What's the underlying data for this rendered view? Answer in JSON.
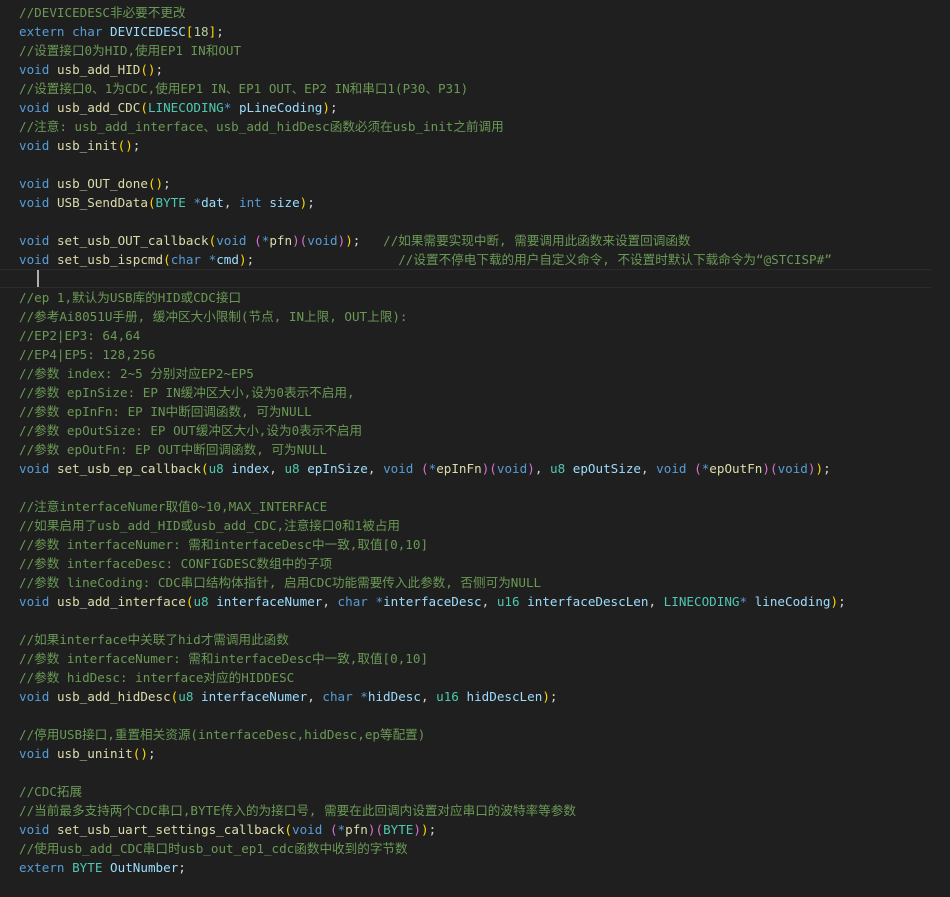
{
  "editor": {
    "theme": {
      "background": "#1f1f1f",
      "comment": "#6a9955",
      "keyword": "#569cd6",
      "type": "#4ec9b0",
      "function": "#dcdcaa",
      "identifier": "#9cdcfe",
      "punctuation": "#d4d4d4",
      "number": "#b5cea8",
      "bracket_1": "#ffd700",
      "bracket_2": "#da70d6",
      "bracket_3": "#179fff"
    },
    "active_line_index": 14,
    "lines": [
      [
        [
          "cm",
          "//DEVICEDESC非必要不更改"
        ]
      ],
      [
        [
          "kw",
          "extern"
        ],
        [
          "pn",
          " "
        ],
        [
          "kw",
          "char"
        ],
        [
          "pn",
          " "
        ],
        [
          "id",
          "DEVICEDESC"
        ],
        [
          "p1",
          "["
        ],
        [
          "nm",
          "18"
        ],
        [
          "p1",
          "]"
        ],
        [
          "pn",
          ";"
        ]
      ],
      [
        [
          "cm",
          "//设置接口0为HID,使用EP1 IN和OUT"
        ]
      ],
      [
        [
          "kw",
          "void"
        ],
        [
          "pn",
          " "
        ],
        [
          "fn",
          "usb_add_HID"
        ],
        [
          "p1",
          "()"
        ],
        [
          "pn",
          ";"
        ]
      ],
      [
        [
          "cm",
          "//设置接口0、1为CDC,使用EP1 IN、EP1 OUT、EP2 IN和串口1(P30、P31)"
        ]
      ],
      [
        [
          "kw",
          "void"
        ],
        [
          "pn",
          " "
        ],
        [
          "fn",
          "usb_add_CDC"
        ],
        [
          "p1",
          "("
        ],
        [
          "ty",
          "LINECODING"
        ],
        [
          "kw",
          "*"
        ],
        [
          "pn",
          " "
        ],
        [
          "id",
          "pLineCoding"
        ],
        [
          "p1",
          ")"
        ],
        [
          "pn",
          ";"
        ]
      ],
      [
        [
          "cm",
          "//注意: usb_add_interface、usb_add_hidDesc函数必须在usb_init之前调用"
        ]
      ],
      [
        [
          "kw",
          "void"
        ],
        [
          "pn",
          " "
        ],
        [
          "fn",
          "usb_init"
        ],
        [
          "p1",
          "()"
        ],
        [
          "pn",
          ";"
        ]
      ],
      [],
      [
        [
          "kw",
          "void"
        ],
        [
          "pn",
          " "
        ],
        [
          "fn",
          "usb_OUT_done"
        ],
        [
          "p1",
          "()"
        ],
        [
          "pn",
          ";"
        ]
      ],
      [
        [
          "kw",
          "void"
        ],
        [
          "pn",
          " "
        ],
        [
          "fn",
          "USB_SendData"
        ],
        [
          "p1",
          "("
        ],
        [
          "ty",
          "BYTE"
        ],
        [
          "pn",
          " "
        ],
        [
          "kw",
          "*"
        ],
        [
          "id",
          "dat"
        ],
        [
          "pn",
          ", "
        ],
        [
          "kw",
          "int"
        ],
        [
          "pn",
          " "
        ],
        [
          "id",
          "size"
        ],
        [
          "p1",
          ")"
        ],
        [
          "pn",
          ";"
        ]
      ],
      [],
      [
        [
          "kw",
          "void"
        ],
        [
          "pn",
          " "
        ],
        [
          "fn",
          "set_usb_OUT_callback"
        ],
        [
          "p1",
          "("
        ],
        [
          "kw",
          "void"
        ],
        [
          "pn",
          " "
        ],
        [
          "p2",
          "("
        ],
        [
          "kw",
          "*"
        ],
        [
          "fn",
          "pfn"
        ],
        [
          "p2",
          ")"
        ],
        [
          "p2",
          "("
        ],
        [
          "kw",
          "void"
        ],
        [
          "p2",
          ")"
        ],
        [
          "p1",
          ")"
        ],
        [
          "pn",
          ";   "
        ],
        [
          "cm",
          "//如果需要实现中断, 需要调用此函数来设置回调函数"
        ]
      ],
      [
        [
          "kw",
          "void"
        ],
        [
          "pn",
          " "
        ],
        [
          "fn",
          "set_usb_ispcmd"
        ],
        [
          "p1",
          "("
        ],
        [
          "kw",
          "char"
        ],
        [
          "pn",
          " "
        ],
        [
          "kw",
          "*"
        ],
        [
          "id",
          "cmd"
        ],
        [
          "p1",
          ")"
        ],
        [
          "pn",
          ";                   "
        ],
        [
          "cm",
          "//设置不停电下载的用户自定义命令, 不设置时默认下载命令为“@STCISP#”"
        ]
      ],
      [],
      [
        [
          "cm",
          "//ep 1,默认为USB库的HID或CDC接口"
        ]
      ],
      [
        [
          "cm",
          "//参考Ai8051U手册, 缓冲区大小限制(节点, IN上限, OUT上限):"
        ]
      ],
      [
        [
          "cm",
          "//EP2|EP3: 64,64"
        ]
      ],
      [
        [
          "cm",
          "//EP4|EP5: 128,256"
        ]
      ],
      [
        [
          "cm",
          "//参数 index: 2~5 分别对应EP2~EP5"
        ]
      ],
      [
        [
          "cm",
          "//参数 epInSize: EP IN缓冲区大小,设为0表示不启用,"
        ]
      ],
      [
        [
          "cm",
          "//参数 epInFn: EP IN中断回调函数, 可为NULL"
        ]
      ],
      [
        [
          "cm",
          "//参数 epOutSize: EP OUT缓冲区大小,设为0表示不启用"
        ]
      ],
      [
        [
          "cm",
          "//参数 epOutFn: EP OUT中断回调函数, 可为NULL"
        ]
      ],
      [
        [
          "kw",
          "void"
        ],
        [
          "pn",
          " "
        ],
        [
          "fn",
          "set_usb_ep_callback"
        ],
        [
          "p1",
          "("
        ],
        [
          "ty",
          "u8"
        ],
        [
          "pn",
          " "
        ],
        [
          "id",
          "index"
        ],
        [
          "pn",
          ", "
        ],
        [
          "ty",
          "u8"
        ],
        [
          "pn",
          " "
        ],
        [
          "id",
          "epInSize"
        ],
        [
          "pn",
          ", "
        ],
        [
          "kw",
          "void"
        ],
        [
          "pn",
          " "
        ],
        [
          "p2",
          "("
        ],
        [
          "kw",
          "*"
        ],
        [
          "fn",
          "epInFn"
        ],
        [
          "p2",
          ")"
        ],
        [
          "p2",
          "("
        ],
        [
          "kw",
          "void"
        ],
        [
          "p2",
          ")"
        ],
        [
          "pn",
          ", "
        ],
        [
          "ty",
          "u8"
        ],
        [
          "pn",
          " "
        ],
        [
          "id",
          "epOutSize"
        ],
        [
          "pn",
          ", "
        ],
        [
          "kw",
          "void"
        ],
        [
          "pn",
          " "
        ],
        [
          "p2",
          "("
        ],
        [
          "kw",
          "*"
        ],
        [
          "fn",
          "epOutFn"
        ],
        [
          "p2",
          ")"
        ],
        [
          "p2",
          "("
        ],
        [
          "kw",
          "void"
        ],
        [
          "p2",
          ")"
        ],
        [
          "p1",
          ")"
        ],
        [
          "pn",
          ";"
        ]
      ],
      [],
      [
        [
          "cm",
          "//注意interfaceNumer取值0~10,MAX_INTERFACE"
        ]
      ],
      [
        [
          "cm",
          "//如果启用了usb_add_HID或usb_add_CDC,注意接口0和1被占用"
        ]
      ],
      [
        [
          "cm",
          "//参数 interfaceNumer: 需和interfaceDesc中一致,取值[0,10]"
        ]
      ],
      [
        [
          "cm",
          "//参数 interfaceDesc: CONFIGDESC数组中的子项"
        ]
      ],
      [
        [
          "cm",
          "//参数 lineCoding: CDC串口结构体指针, 启用CDC功能需要传入此参数, 否侧可为NULL"
        ]
      ],
      [
        [
          "kw",
          "void"
        ],
        [
          "pn",
          " "
        ],
        [
          "fn",
          "usb_add_interface"
        ],
        [
          "p1",
          "("
        ],
        [
          "ty",
          "u8"
        ],
        [
          "pn",
          " "
        ],
        [
          "id",
          "interfaceNumer"
        ],
        [
          "pn",
          ", "
        ],
        [
          "kw",
          "char"
        ],
        [
          "pn",
          " "
        ],
        [
          "kw",
          "*"
        ],
        [
          "id",
          "interfaceDesc"
        ],
        [
          "pn",
          ", "
        ],
        [
          "ty",
          "u16"
        ],
        [
          "pn",
          " "
        ],
        [
          "id",
          "interfaceDescLen"
        ],
        [
          "pn",
          ", "
        ],
        [
          "ty",
          "LINECODING"
        ],
        [
          "kw",
          "*"
        ],
        [
          "pn",
          " "
        ],
        [
          "id",
          "lineCoding"
        ],
        [
          "p1",
          ")"
        ],
        [
          "pn",
          ";"
        ]
      ],
      [],
      [
        [
          "cm",
          "//如果interface中关联了hid才需调用此函数"
        ]
      ],
      [
        [
          "cm",
          "//参数 interfaceNumer: 需和interfaceDesc中一致,取值[0,10]"
        ]
      ],
      [
        [
          "cm",
          "//参数 hidDesc: interface对应的HIDDESC"
        ]
      ],
      [
        [
          "kw",
          "void"
        ],
        [
          "pn",
          " "
        ],
        [
          "fn",
          "usb_add_hidDesc"
        ],
        [
          "p1",
          "("
        ],
        [
          "ty",
          "u8"
        ],
        [
          "pn",
          " "
        ],
        [
          "id",
          "interfaceNumer"
        ],
        [
          "pn",
          ", "
        ],
        [
          "kw",
          "char"
        ],
        [
          "pn",
          " "
        ],
        [
          "kw",
          "*"
        ],
        [
          "id",
          "hidDesc"
        ],
        [
          "pn",
          ", "
        ],
        [
          "ty",
          "u16"
        ],
        [
          "pn",
          " "
        ],
        [
          "id",
          "hidDescLen"
        ],
        [
          "p1",
          ")"
        ],
        [
          "pn",
          ";"
        ]
      ],
      [],
      [
        [
          "cm",
          "//停用USB接口,重置相关资源(interfaceDesc,hidDesc,ep等配置)"
        ]
      ],
      [
        [
          "kw",
          "void"
        ],
        [
          "pn",
          " "
        ],
        [
          "fn",
          "usb_uninit"
        ],
        [
          "p1",
          "()"
        ],
        [
          "pn",
          ";"
        ]
      ],
      [],
      [
        [
          "cm",
          "//CDC拓展"
        ]
      ],
      [
        [
          "cm",
          "//当前最多支持两个CDC串口,BYTE传入的为接口号, 需要在此回调内设置对应串口的波特率等参数"
        ]
      ],
      [
        [
          "kw",
          "void"
        ],
        [
          "pn",
          " "
        ],
        [
          "fn",
          "set_usb_uart_settings_callback"
        ],
        [
          "p1",
          "("
        ],
        [
          "kw",
          "void"
        ],
        [
          "pn",
          " "
        ],
        [
          "p2",
          "("
        ],
        [
          "kw",
          "*"
        ],
        [
          "fn",
          "pfn"
        ],
        [
          "p2",
          ")"
        ],
        [
          "p2",
          "("
        ],
        [
          "ty",
          "BYTE"
        ],
        [
          "p2",
          ")"
        ],
        [
          "p1",
          ")"
        ],
        [
          "pn",
          ";"
        ]
      ],
      [
        [
          "cm",
          "//使用usb_add_CDC串口时usb_out_ep1_cdc函数中收到的字节数"
        ]
      ],
      [
        [
          "kw",
          "extern"
        ],
        [
          "pn",
          " "
        ],
        [
          "ty",
          "BYTE"
        ],
        [
          "pn",
          " "
        ],
        [
          "id",
          "OutNumber"
        ],
        [
          "pn",
          ";"
        ]
      ]
    ]
  }
}
